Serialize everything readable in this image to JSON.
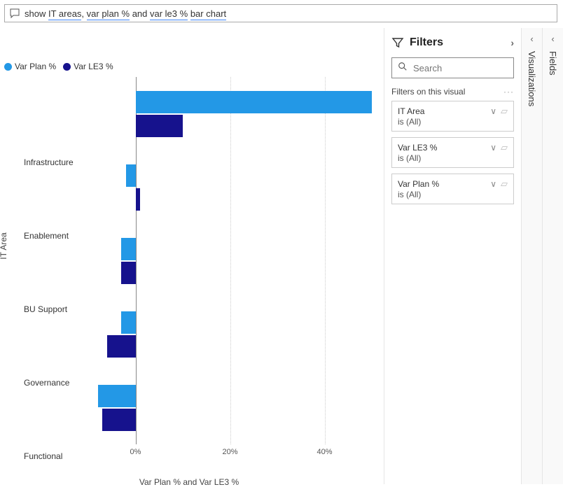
{
  "query_bar": {
    "prefix": "show ",
    "p1": "IT areas",
    "sep1": ", ",
    "p2": "var plan %",
    "sep2": " and ",
    "p3": "var le3 %",
    "sep3": " ",
    "p4": "bar chart"
  },
  "legend": {
    "series1_label": "Var Plan %",
    "series2_label": "Var LE3 %"
  },
  "axis": {
    "y_title": "IT Area",
    "x_title": "Var Plan % and Var LE3 %"
  },
  "colors": {
    "series1": "#2398E6",
    "series2": "#16128D"
  },
  "filters_pane": {
    "title": "Filters",
    "search_placeholder": "Search",
    "section_label": "Filters on this visual",
    "cards": [
      {
        "name": "IT Area",
        "value": "is (All)"
      },
      {
        "name": "Var LE3 %",
        "value": "is (All)"
      },
      {
        "name": "Var Plan %",
        "value": "is (All)"
      }
    ]
  },
  "rails": {
    "visualizations": "Visualizations",
    "fields": "Fields"
  },
  "x_ticks": [
    {
      "label": "0%",
      "value": 0
    },
    {
      "label": "20%",
      "value": 20
    },
    {
      "label": "40%",
      "value": 40
    }
  ],
  "chart_data": {
    "type": "bar",
    "orientation": "horizontal",
    "categories": [
      "Infrastructure",
      "Enablement",
      "BU Support",
      "Governance",
      "Functional"
    ],
    "series": [
      {
        "name": "Var Plan %",
        "values": [
          50,
          -2,
          -3,
          -3,
          -8
        ]
      },
      {
        "name": "Var LE3 %",
        "values": [
          10,
          1,
          -3,
          -6,
          -7
        ]
      }
    ],
    "xlabel": "Var Plan % and Var LE3 %",
    "ylabel": "IT Area",
    "xlim": [
      -10,
      50
    ]
  }
}
